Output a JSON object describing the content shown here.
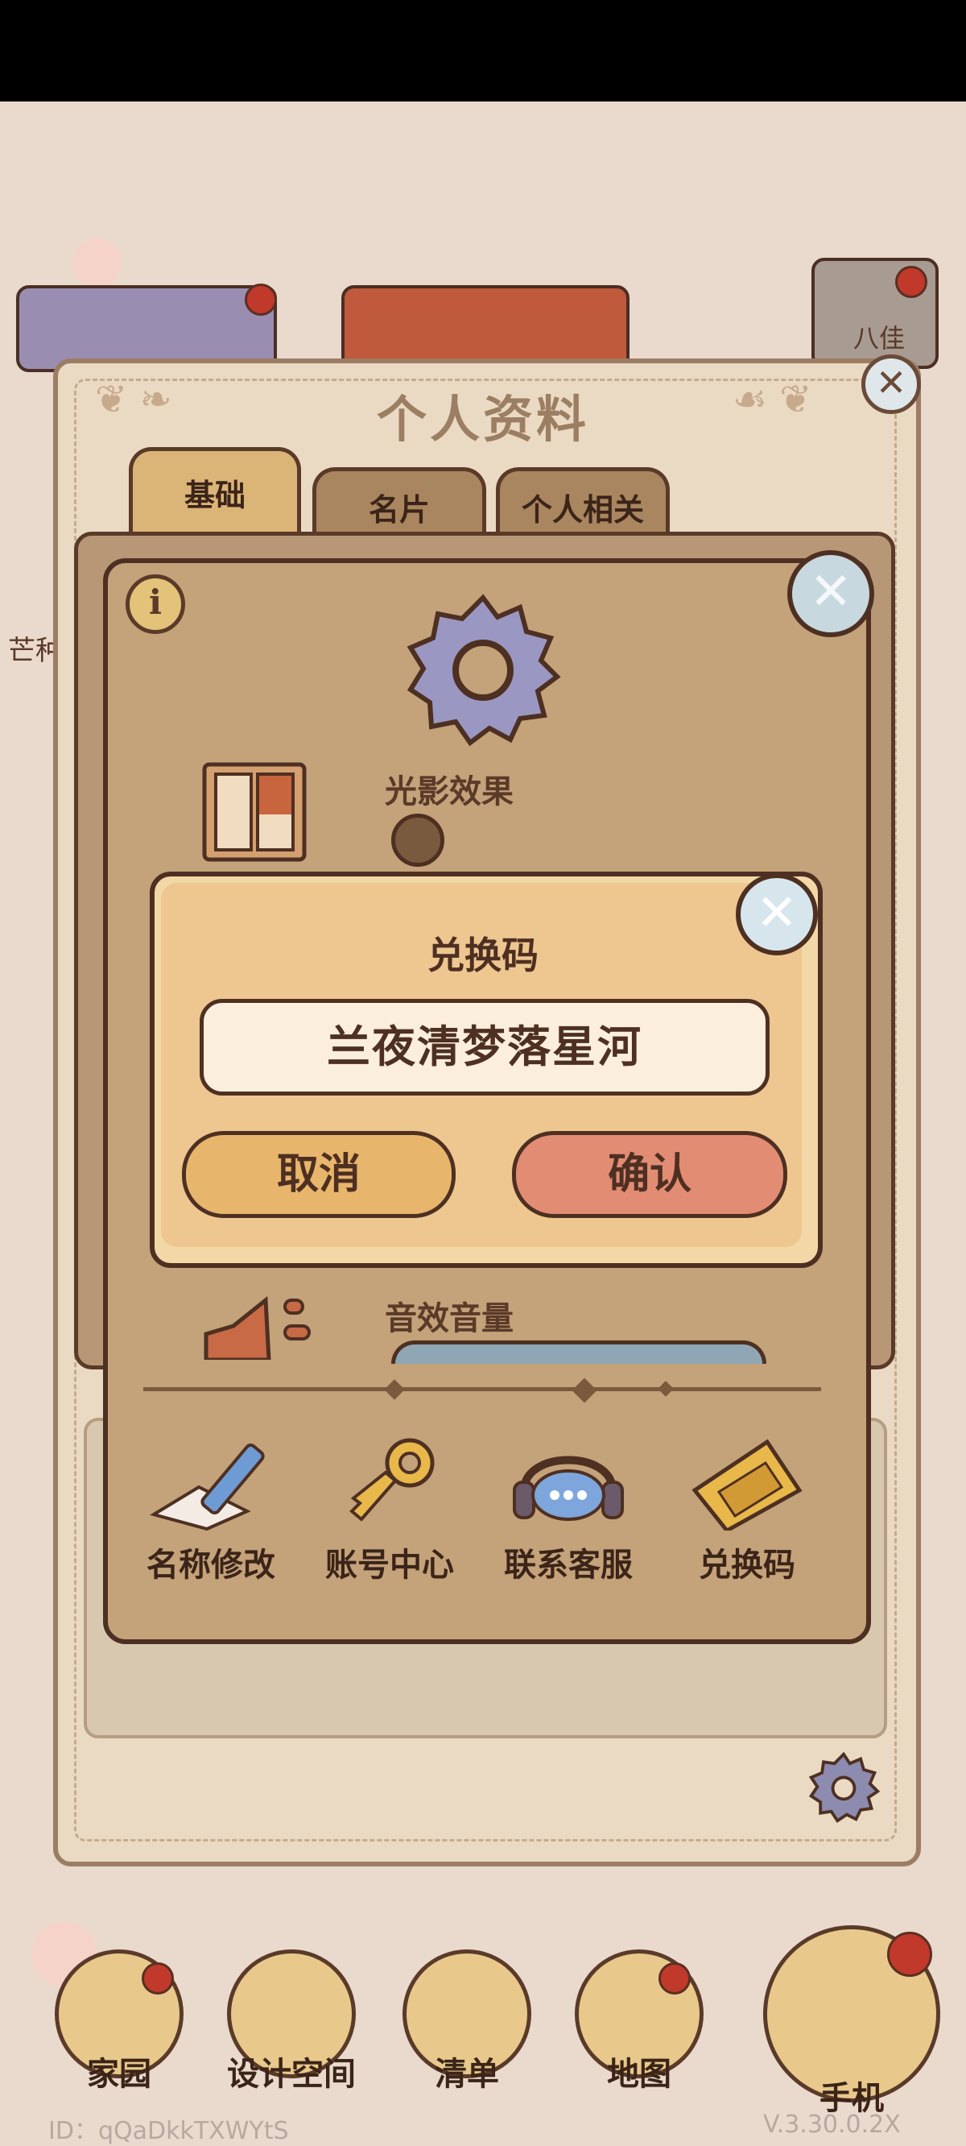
{
  "panel": {
    "title": "个人资料"
  },
  "tabs": [
    {
      "label": "基础"
    },
    {
      "label": "名片"
    },
    {
      "label": "个人相关"
    }
  ],
  "settings": {
    "lighting_label": "光影效果",
    "sfx_label": "音效音量",
    "actions": [
      {
        "label": "名称修改",
        "icon": "pencil-paper-icon"
      },
      {
        "label": "账号中心",
        "icon": "key-icon"
      },
      {
        "label": "联系客服",
        "icon": "headset-chat-icon"
      },
      {
        "label": "兑换码",
        "icon": "ticket-icon"
      }
    ]
  },
  "dialog": {
    "title": "兑换码",
    "code_value": "兰夜清梦落星河",
    "cancel_label": "取消",
    "confirm_label": "确认"
  },
  "hud": {
    "left_label_partial": "芒种",
    "right_label_partial": "八佳"
  },
  "bottom_nav": [
    {
      "label": "家园",
      "icon": "home-icon"
    },
    {
      "label": "设计空间",
      "icon": "design-icon"
    },
    {
      "label": "清单",
      "icon": "list-icon"
    },
    {
      "label": "地图",
      "icon": "map-pin-icon"
    },
    {
      "label": "手机",
      "icon": "phone-icon"
    }
  ],
  "footer": {
    "uid": "ID：qQaDkkTXWYtS",
    "version": "V.3.30.0.2X"
  },
  "colors": {
    "dialog_bg": "#f3d8a7",
    "cancel_button": "#e8b56c",
    "confirm_button": "#e38c74",
    "outline": "#4e3022"
  }
}
